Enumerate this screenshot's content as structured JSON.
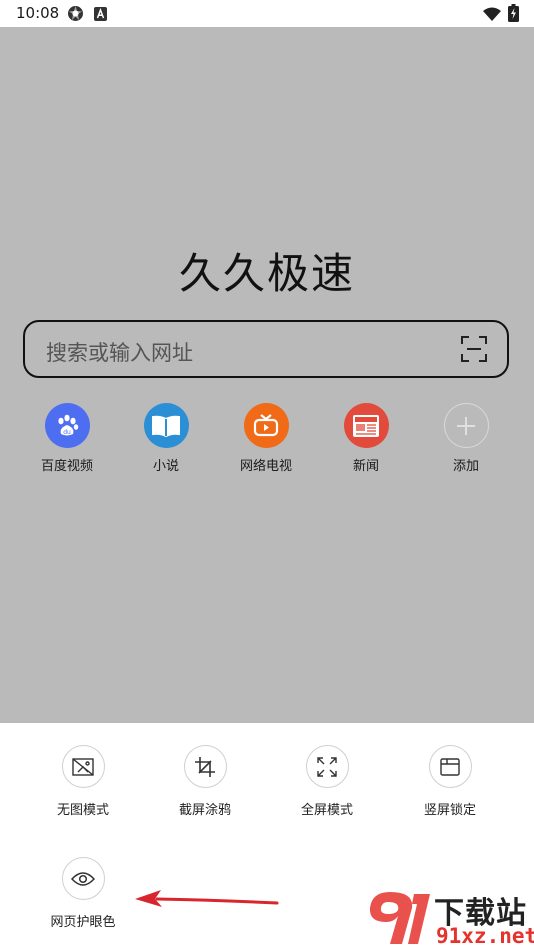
{
  "status": {
    "time": "10:08"
  },
  "brand": {
    "title": "久久极速"
  },
  "search": {
    "placeholder": "搜索或输入网址"
  },
  "shortcuts": [
    {
      "label": "百度视频",
      "icon": "baidu-paw-icon",
      "color": "#4e6ef2"
    },
    {
      "label": "小说",
      "icon": "book-icon",
      "color": "#2b8fd6"
    },
    {
      "label": "网络电视",
      "icon": "tv-icon",
      "color": "#f06a18"
    },
    {
      "label": "新闻",
      "icon": "news-icon",
      "color": "#e24a3b"
    },
    {
      "label": "添加",
      "icon": "plus-icon",
      "color": "#bababa"
    }
  ],
  "tools": [
    {
      "label": "无图模式",
      "icon": "no-image-icon"
    },
    {
      "label": "截屏涂鸦",
      "icon": "crop-icon"
    },
    {
      "label": "全屏模式",
      "icon": "fullscreen-icon"
    },
    {
      "label": "竖屏锁定",
      "icon": "screen-lock-icon"
    },
    {
      "label": "网页护眼色",
      "icon": "eye-icon"
    }
  ],
  "watermark": {
    "name": "下载站",
    "domain": "91xz.net"
  },
  "colors": {
    "overlay": "#bababa",
    "arrow": "#d9262e",
    "watermark_red": "#e5322d"
  }
}
